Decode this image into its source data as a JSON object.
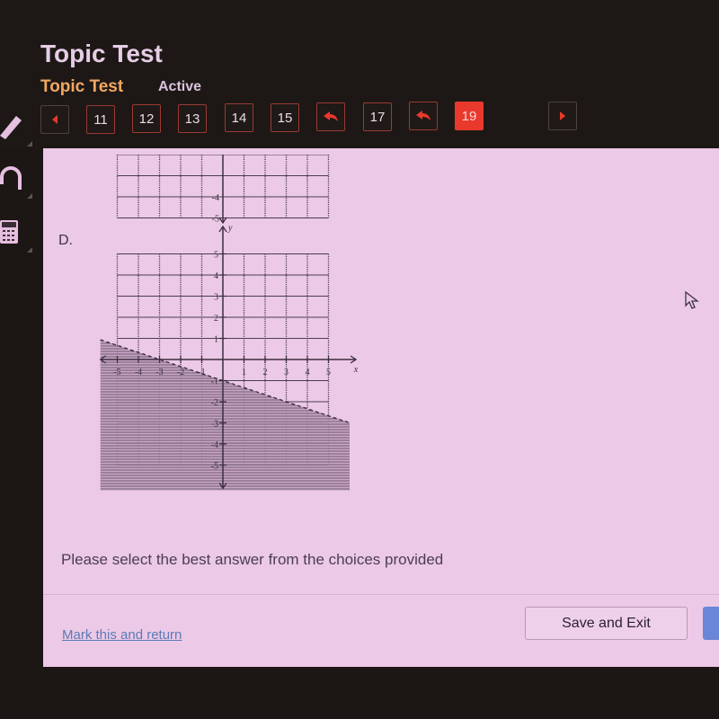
{
  "header": {
    "title": "Topic Test",
    "subtitle": "Topic Test",
    "status": "Active"
  },
  "nav": {
    "prev_icon": "left-triangle-icon",
    "next_icon": "right-triangle-icon",
    "items": [
      {
        "label": "11",
        "type": "number"
      },
      {
        "label": "12",
        "type": "number"
      },
      {
        "label": "13",
        "type": "number"
      },
      {
        "label": "14",
        "type": "number"
      },
      {
        "label": "15",
        "type": "number"
      },
      {
        "label": "",
        "type": "return-arrow",
        "icon": "return-arrow-icon"
      },
      {
        "label": "17",
        "type": "number"
      },
      {
        "label": "",
        "type": "return-arrow",
        "icon": "return-arrow-icon"
      },
      {
        "label": "19",
        "type": "number",
        "current": true
      }
    ]
  },
  "tools": [
    {
      "name": "pencil",
      "icon": "pencil-icon"
    },
    {
      "name": "headphones",
      "icon": "headphones-icon"
    },
    {
      "name": "calculator",
      "icon": "calculator-icon"
    }
  ],
  "question": {
    "option_label": "D.",
    "instruction": "Please select the best answer from the choices provided"
  },
  "footer": {
    "mark_link": "Mark this and return",
    "save_label": "Save and Exit"
  },
  "colors": {
    "accent_red": "#e8392c",
    "subtitle_orange": "#f0a862",
    "content_bg": "#ecc9e6",
    "link_blue": "#5c7bb8",
    "next_button_blue": "#6a86d8"
  },
  "chart_data": [
    {
      "type": "graph-partial",
      "description": "Bottom portion of previous option's coordinate grid (cut off)",
      "visible_y_ticks": [
        "-4",
        "-5"
      ],
      "xlim": [
        -5,
        5
      ],
      "visible_ylim": [
        -5,
        -3
      ]
    },
    {
      "type": "linear-inequality",
      "option": "D",
      "xlabel": "x",
      "ylabel": "y",
      "xlim": [
        -5,
        5
      ],
      "ylim": [
        -5,
        5
      ],
      "x_ticks": [
        "-5",
        "-4",
        "-3",
        "-2",
        "-1",
        "1",
        "2",
        "3",
        "4",
        "5"
      ],
      "y_ticks": [
        "5",
        "4",
        "3",
        "2",
        "1",
        "-1",
        "-2",
        "-3",
        "-4",
        "-5"
      ],
      "boundary": {
        "slope": -0.3333,
        "intercept": -1,
        "style": "dashed",
        "points": [
          [
            -3,
            0
          ],
          [
            0,
            -1
          ]
        ]
      },
      "shading": "below",
      "inequality": "y < -1/3 x - 1",
      "grid": true
    }
  ]
}
